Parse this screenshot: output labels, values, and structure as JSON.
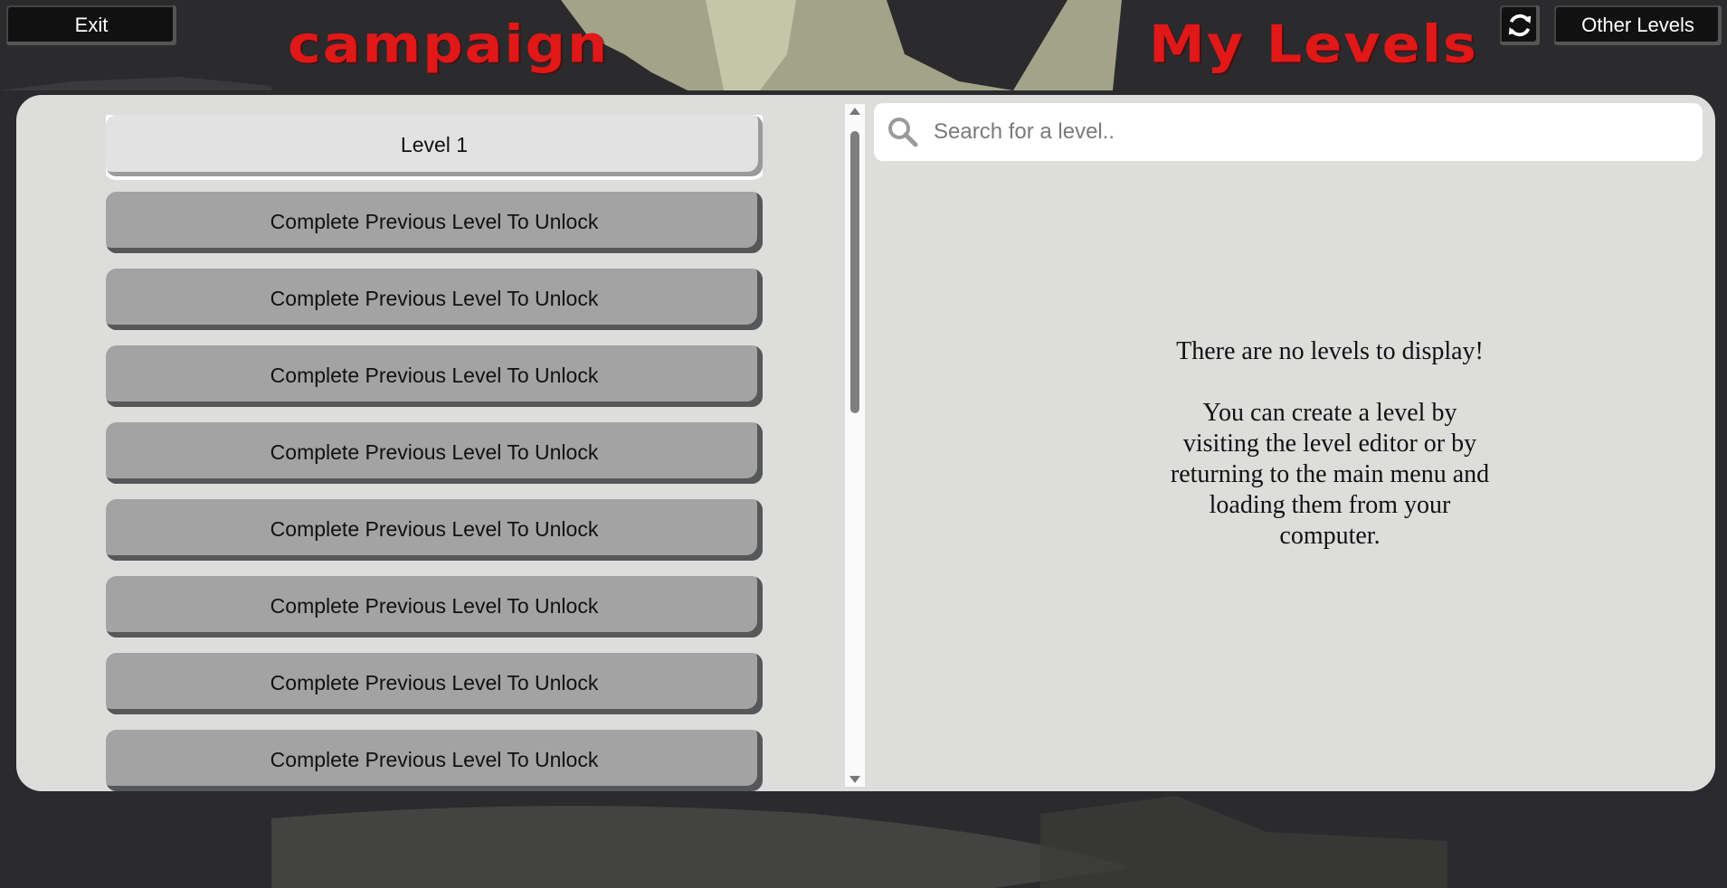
{
  "header": {
    "exit_label": "Exit",
    "campaign_title": "campaign",
    "mylevels_title": "My Levels",
    "other_levels_label": "Other Levels",
    "refresh_icon": "refresh-icon"
  },
  "campaign": {
    "levels": [
      {
        "label": "Level 1",
        "unlocked": true
      },
      {
        "label": "Complete Previous Level To Unlock",
        "unlocked": false
      },
      {
        "label": "Complete Previous Level To Unlock",
        "unlocked": false
      },
      {
        "label": "Complete Previous Level To Unlock",
        "unlocked": false
      },
      {
        "label": "Complete Previous Level To Unlock",
        "unlocked": false
      },
      {
        "label": "Complete Previous Level To Unlock",
        "unlocked": false
      },
      {
        "label": "Complete Previous Level To Unlock",
        "unlocked": false
      },
      {
        "label": "Complete Previous Level To Unlock",
        "unlocked": false
      },
      {
        "label": "Complete Previous Level To Unlock",
        "unlocked": false
      }
    ]
  },
  "my_levels": {
    "search_placeholder": "Search for a level..",
    "search_value": "",
    "empty_line1": "There are no levels to display!",
    "empty_line2": "You can create a level by visiting the level editor or by returning to the main menu and loading them from your computer."
  },
  "colors": {
    "title_red": "#e01818",
    "background": "#2b2a2d",
    "locked_button": "#a2a3a2",
    "unlocked_button": "#e2e2e2"
  }
}
